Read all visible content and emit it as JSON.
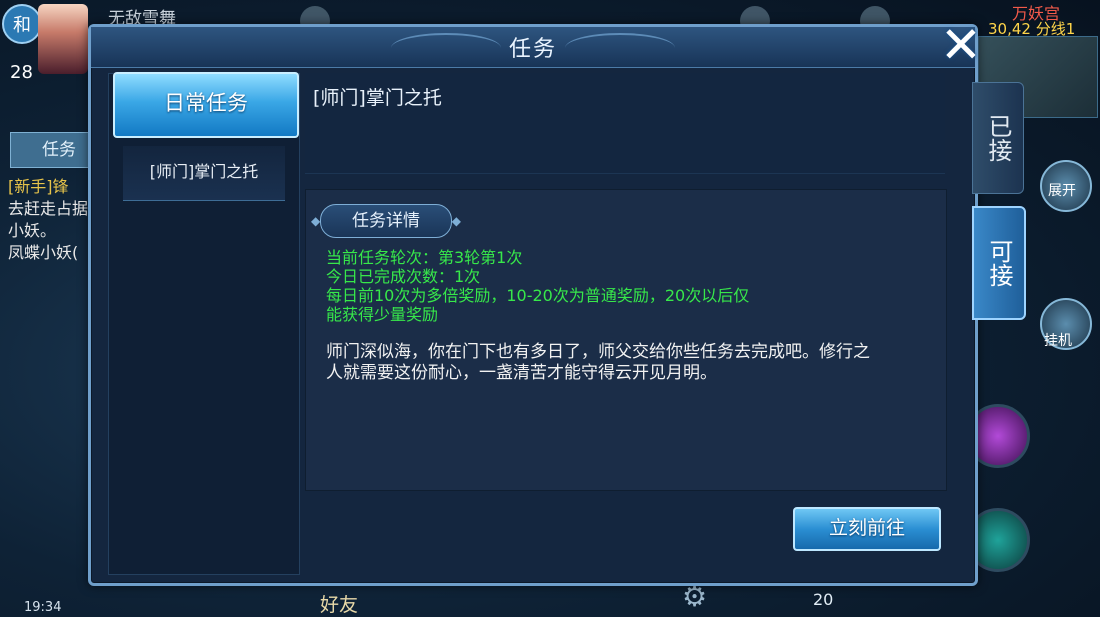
{
  "hud": {
    "badge": "和",
    "level": "28",
    "player_name": "无敌雪舞",
    "map_name": "万妖宫",
    "coords_line": "30,42 分线1",
    "left_task_tab": "任务",
    "left_task_title": "[新手]锋",
    "left_task_body": "去赶走占据小妖。",
    "left_task_extra": "凤蝶小妖(",
    "time": "19:34",
    "bottom_friend": "好友",
    "bottom_count": "20",
    "expand_label": "展开",
    "afk_label": "挂机"
  },
  "dialog": {
    "title": "任务",
    "category_button": "日常任务",
    "task_item": "[师门]掌门之托",
    "task_title": "[师门]掌门之托",
    "detail_label": "任务详情",
    "green_lines": [
      "当前任务轮次：第3轮第1次",
      "今日已完成次数：1次",
      "每日前10次为多倍奖励，10-20次为普通奖励，20次以后仅",
      "能获得少量奖励"
    ],
    "description": "师门深似海，你在门下也有多日了，师父交给你些任务去完成吧。修行之人就需要这份耐心，一盏清苦才能守得云开见月明。",
    "go_button": "立刻前往",
    "tab_accepted": "已接",
    "tab_available": "可接",
    "close_icon": "✕"
  }
}
